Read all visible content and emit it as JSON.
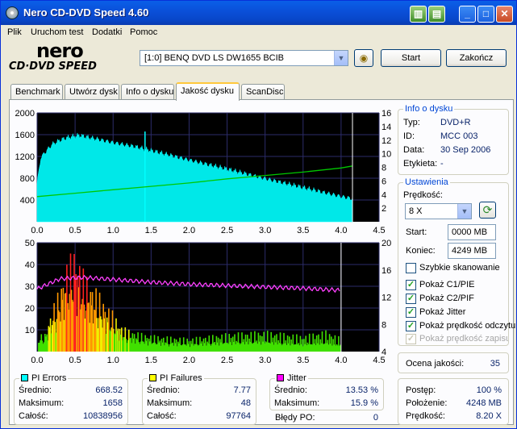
{
  "window": {
    "title": "Nero CD-DVD Speed 4.60"
  },
  "menu": [
    "Plik",
    "Uruchom test",
    "Dodatki",
    "Pomoc"
  ],
  "logo": {
    "line1": "nero",
    "line2": "CD·DVD SPEED"
  },
  "drive": {
    "selected": "[1:0]  BENQ DVD LS DW1655 BCIB"
  },
  "buttons": {
    "start": "Start",
    "end": "Zakończ"
  },
  "tabs": [
    "Benchmark",
    "Utwórz dysk",
    "Info o dysku",
    "Jakość dysku",
    "ScanDisc"
  ],
  "active_tab": "Jakość dysku",
  "disc_info": {
    "title": "Info o dysku",
    "type_label": "Typ:",
    "type": "DVD+R",
    "id_label": "ID:",
    "id": "MCC 003",
    "date_label": "Data:",
    "date": "30 Sep 2006",
    "label_label": "Etykieta:",
    "label": "-"
  },
  "settings": {
    "title": "Ustawienia",
    "speed_label": "Prędkość:",
    "speed": "8 X",
    "start_label": "Start:",
    "start": "0000 MB",
    "end_label": "Koniec:",
    "end": "4249 MB",
    "quick_scan": "Szybkie skanowanie",
    "show_c1": "Pokaż C1/PIE",
    "show_c2": "Pokaż C2/PIF",
    "show_jitter": "Pokaż Jitter",
    "show_read_speed": "Pokaż prędkość odczytu",
    "show_write_speed": "Pokaż prędkość zapisu"
  },
  "quality": {
    "label": "Ocena jakości:",
    "value": "35"
  },
  "progress": {
    "progress_label": "Postęp:",
    "progress": "100 %",
    "position_label": "Położenie:",
    "position": "4248 MB",
    "speed_label": "Prędkość:",
    "speed": "8.20 X"
  },
  "pi_errors": {
    "title": "PI Errors",
    "color": "#00ffff",
    "avg_label": "Średnio:",
    "avg": "668.52",
    "max_label": "Maksimum:",
    "max": "1658",
    "total_label": "Całość:",
    "total": "10838956"
  },
  "pi_failures": {
    "title": "PI Failures",
    "color": "#ffff00",
    "avg_label": "Średnio:",
    "avg": "7.77",
    "max_label": "Maksimum:",
    "max": "48",
    "total_label": "Całość:",
    "total": "97764"
  },
  "jitter": {
    "title": "Jitter",
    "color": "#ff00ff",
    "avg_label": "Średnio:",
    "avg": "13.53 %",
    "max_label": "Maksimum:",
    "max": "15.9 %",
    "po_label": "Błędy PO:",
    "po": "0"
  },
  "chart_data": [
    {
      "type": "area",
      "series": [
        {
          "name": "PI Errors",
          "x": [
            0.0,
            0.05,
            0.2,
            0.3,
            0.4,
            0.55,
            0.8,
            1.0,
            1.3,
            1.5,
            1.8,
            2.0,
            2.5,
            3.0,
            3.5,
            4.0,
            4.15
          ],
          "y": [
            700,
            1180,
            1420,
            1490,
            1540,
            1580,
            1510,
            1450,
            1370,
            1300,
            1200,
            1130,
            960,
            790,
            620,
            460,
            420
          ]
        },
        {
          "name": "Read speed",
          "x": [
            0.0,
            0.5,
            1.0,
            1.5,
            2.0,
            2.5,
            3.0,
            3.5,
            4.0,
            4.15
          ],
          "y": [
            3.7,
            4.2,
            4.7,
            5.2,
            5.7,
            6.3,
            6.8,
            7.3,
            7.9,
            8.2
          ]
        }
      ],
      "xlim": [
        0,
        4.5
      ],
      "ylim": [
        0,
        2000
      ],
      "y2lim": [
        0,
        16
      ],
      "xticks": [
        "0.0",
        "0.5",
        "1.0",
        "1.5",
        "2.0",
        "2.5",
        "3.0",
        "3.5",
        "4.0",
        "4.5"
      ],
      "yticks": [
        "400",
        "800",
        "1200",
        "1600",
        "2000"
      ],
      "y2ticks": [
        "2",
        "4",
        "6",
        "8",
        "10",
        "12",
        "14",
        "16"
      ],
      "spikes": [
        {
          "x": 1.42,
          "y": 1658
        }
      ]
    },
    {
      "type": "bar",
      "series": [
        {
          "name": "PI Failures",
          "x": [
            0.1,
            0.2,
            0.3,
            0.4,
            0.5,
            0.6,
            0.7,
            0.8,
            0.9,
            1.0,
            1.1,
            1.2,
            1.4,
            1.6,
            2.0,
            2.5,
            3.0,
            3.5,
            3.8,
            4.0
          ],
          "y": [
            8,
            20,
            30,
            42,
            48,
            38,
            32,
            28,
            22,
            18,
            12,
            10,
            8,
            7,
            6,
            8,
            9,
            7,
            9,
            6
          ]
        },
        {
          "name": "Jitter",
          "x": [
            0.0,
            0.3,
            0.6,
            1.0,
            1.5,
            2.0,
            2.5,
            3.0,
            3.5,
            4.0,
            4.15
          ],
          "y": [
            13.2,
            14.7,
            14.9,
            14.6,
            14.2,
            13.9,
            13.7,
            13.5,
            13.3,
            13.0,
            13.0
          ]
        }
      ],
      "xlim": [
        0,
        4.5
      ],
      "ylim": [
        0,
        50
      ],
      "y2lim": [
        4,
        20
      ],
      "xticks": [
        "0.0",
        "0.5",
        "1.0",
        "1.5",
        "2.0",
        "2.5",
        "3.0",
        "3.5",
        "4.0",
        "4.5"
      ],
      "yticks": [
        "10",
        "20",
        "30",
        "40",
        "50"
      ],
      "y2ticks": [
        "4",
        "8",
        "12",
        "16",
        "20"
      ]
    }
  ]
}
